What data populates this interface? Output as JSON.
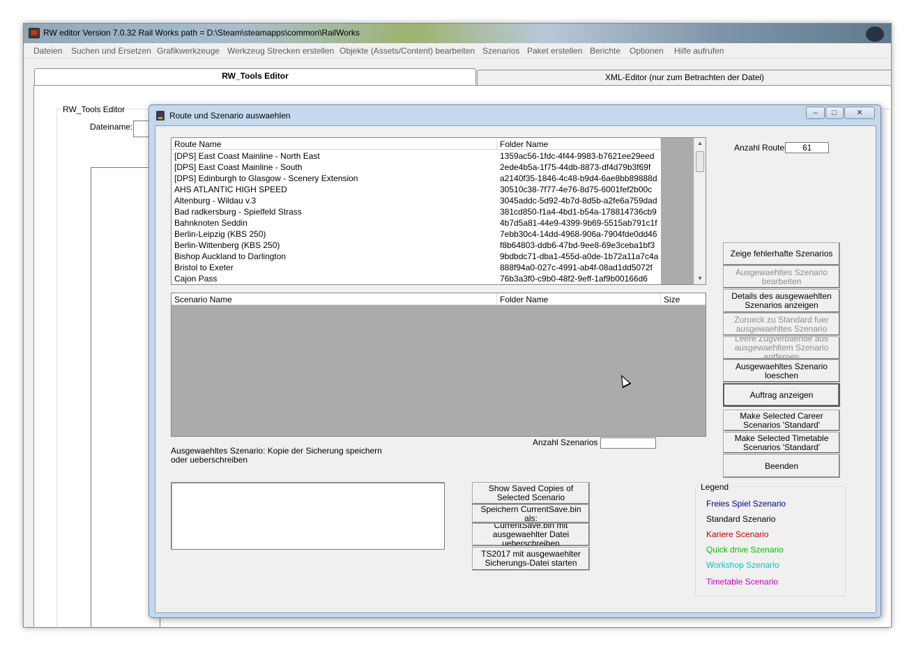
{
  "main_window": {
    "title": "RW editor  Version 7.0.32   Rail Works path = D:\\Steam\\steamapps\\common\\RailWorks",
    "menu": [
      "Dateien",
      "Suchen und Ersetzen",
      "Grafikwerkzeuge",
      "Werkzeug Strecken erstellen",
      "Objekte (Assets/Content) bearbeiten",
      "Szenarios",
      "Paket erstellen",
      "Berichte",
      "Optionen",
      "Hilfe aufrufen"
    ],
    "tabs": [
      "RW_Tools Editor",
      "XML-Editor (nur zum Betrachten der Datei)"
    ],
    "group_label": "RW_Tools Editor",
    "file_label": "Dateiname:"
  },
  "dialog": {
    "title": "Route und Szenario auswaehlen",
    "window_buttons": [
      "–",
      "□",
      "✕"
    ],
    "route_list": {
      "columns": [
        "Route Name",
        "Folder Name"
      ],
      "rows": [
        [
          "[DPS] East Coast Mainline - North East",
          "1359ac56-1fdc-4f44-9983-b7621ee29eed"
        ],
        [
          "[DPS] East Coast Mainline - South",
          "2ede4b5a-1f75-44db-8873-df4d79b3f69f"
        ],
        [
          "[DPS] Edinburgh to Glasgow - Scenery Extension",
          "a2140f35-1846-4c48-b9d4-6ae8bb89888d"
        ],
        [
          "AHS ATLANTIC HIGH SPEED",
          "30510c38-7f77-4e76-8d75-6001fef2b00c"
        ],
        [
          "Altenburg - Wildau v.3",
          "3045addc-5d92-4b7d-8d5b-a2fe6a759dad"
        ],
        [
          "Bad radkersburg - Spielfeld Strass",
          "381cd850-f1a4-4bd1-b54a-178814736cb9"
        ],
        [
          "Bahnknoten Seddin",
          "4b7d5a81-44e9-4399-9b69-5515ab791c1f"
        ],
        [
          "Berlin-Leipzig (KBS 250)",
          "7ebb30c4-14dd-4968-906a-7904fde0dd46"
        ],
        [
          "Berlin-Wittenberg (KBS 250)",
          "f8b64803-ddb6-47bd-9ee8-69e3ceba1bf3"
        ],
        [
          "Bishop Auckland to Darlington",
          "9bdbdc71-dba1-455d-a0de-1b72a11a7c4a"
        ],
        [
          "Bristol to Exeter",
          "888f94a0-027c-4991-ab4f-08ad1dd5072f"
        ],
        [
          "Cajon Pass",
          "76b3a3f0-c9b0-48f2-9eff-1af9b00166d6"
        ]
      ]
    },
    "scenario_list": {
      "columns": [
        "Scenario Name",
        "Folder Name",
        "Size"
      ]
    },
    "route_count_label": "Anzahl Routen",
    "route_count_value": "61",
    "scenario_count_label": "Anzahl Szenarios",
    "scenario_count_value": "",
    "side_buttons": [
      {
        "label": "Zeige fehlerhafte Szenarios",
        "disabled": false
      },
      {
        "label": "Ausgewaehltes Szenario bearbeiten",
        "disabled": true
      },
      {
        "label": "Details des ausgewaehlten Szenarios anzeigen",
        "disabled": false
      },
      {
        "label": "Zurueck zu Standard fuer ausgewaehltes Szenario",
        "disabled": true
      },
      {
        "label": "Leere Zugverbaende aus ausgewaehltem Szenario entfernen",
        "disabled": true
      },
      {
        "label": "Ausgewaehltes Szenario loeschen",
        "disabled": false
      },
      {
        "label": "Auftrag anzeigen",
        "disabled": false
      },
      {
        "label": "Make Selected Career Scenarios 'Standard'",
        "disabled": false
      },
      {
        "label": "Make Selected Timetable Scenarios 'Standard'",
        "disabled": false
      },
      {
        "label": "Beenden",
        "disabled": false
      }
    ],
    "backup_label": "Ausgewaehltes Szenario: Kopie der Sicherung speichern oder ueberschreiben",
    "backup_buttons": [
      "Show Saved Copies of Selected Scenario",
      "Speichern CurrentSave.bin als:",
      "CurrentSave.bin mit ausgewaehlter Datei ueberschreiben",
      "TS2017 mit ausgewaehlter Sicherungs-Datei starten"
    ],
    "legend": {
      "title": "Legend",
      "items": [
        {
          "label": "Freies Spiel Szenario",
          "color": "#00008b"
        },
        {
          "label": "Standard Szenario",
          "color": "#000000"
        },
        {
          "label": "Kariere Scenario",
          "color": "#c00000"
        },
        {
          "label": "Quick drive Szenario",
          "color": "#00c000"
        },
        {
          "label": "Workshop Szenario",
          "color": "#00c8c8"
        },
        {
          "label": "Timetable Scenario",
          "color": "#c000c0"
        }
      ]
    }
  }
}
